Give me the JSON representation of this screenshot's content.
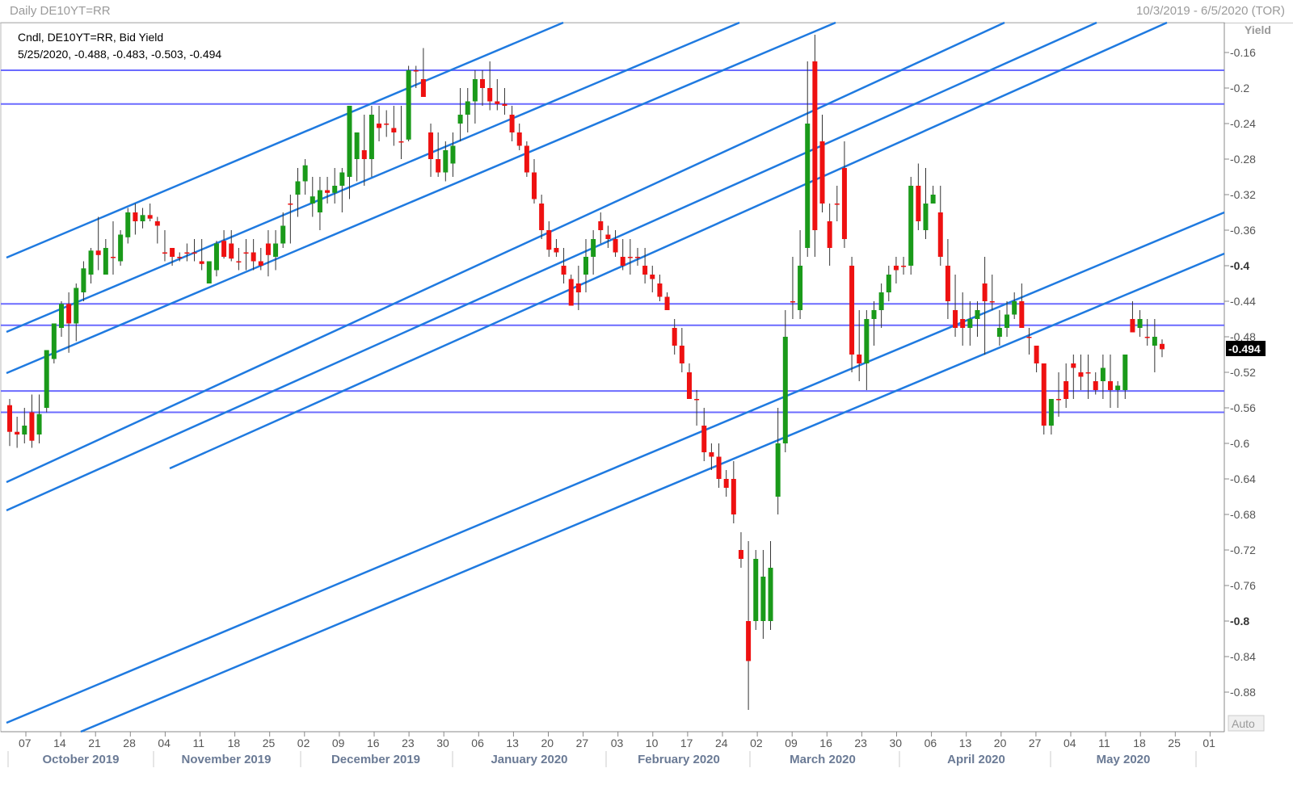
{
  "window": {
    "title": "Daily DE10YT=RR",
    "date_range": "10/3/2019 - 6/5/2020 (TOR)"
  },
  "legend": {
    "line1": "Cndl, DE10YT=RR, Bid Yield",
    "line2": "5/25/2020, -0.488, -0.483, -0.503, -0.494"
  },
  "y_axis": {
    "title": "Yield",
    "auto_label": "Auto",
    "last_value_label": "-0.494"
  },
  "colors": {
    "up": "#1a9a1a",
    "down": "#ee1111",
    "trend_line": "#1f7ae0",
    "horizontal_line": "#6b6bff",
    "last_value_bg": "#000000"
  },
  "chart_data": {
    "type": "candlestick",
    "title": "Cndl, DE10YT=RR, Bid Yield",
    "ylabel": "Yield",
    "ylim": [
      -0.92,
      -0.12
    ],
    "yticks": [
      -0.16,
      -0.2,
      -0.24,
      -0.28,
      -0.32,
      -0.36,
      -0.4,
      -0.44,
      -0.48,
      -0.52,
      -0.56,
      -0.6,
      -0.64,
      -0.68,
      -0.72,
      -0.76,
      -0.8,
      -0.84,
      -0.88
    ],
    "x_tick_labels": [
      "07",
      "14",
      "21",
      "28",
      "04",
      "11",
      "18",
      "25",
      "02",
      "09",
      "16",
      "23",
      "30",
      "06",
      "13",
      "20",
      "27",
      "03",
      "10",
      "17",
      "24",
      "02",
      "09",
      "16",
      "23",
      "30",
      "06",
      "13",
      "20",
      "27",
      "04",
      "11",
      "18",
      "25",
      "01"
    ],
    "month_labels": [
      "October 2019",
      "November 2019",
      "December 2019",
      "January 2020",
      "February 2020",
      "March 2020",
      "April 2020",
      "May 2020"
    ],
    "candles": [
      {
        "date": "2019-10-03",
        "o": -0.557,
        "h": -0.55,
        "l": -0.603,
        "c": -0.587
      },
      {
        "date": "2019-10-04",
        "o": -0.587,
        "h": -0.57,
        "l": -0.605,
        "c": -0.59
      },
      {
        "date": "2019-10-07",
        "o": -0.59,
        "h": -0.56,
        "l": -0.6,
        "c": -0.58
      },
      {
        "date": "2019-10-08",
        "o": -0.565,
        "h": -0.545,
        "l": -0.605,
        "c": -0.597
      },
      {
        "date": "2019-10-09",
        "o": -0.59,
        "h": -0.545,
        "l": -0.6,
        "c": -0.567
      },
      {
        "date": "2019-10-10",
        "o": -0.56,
        "h": -0.495,
        "l": -0.565,
        "c": -0.495
      },
      {
        "date": "2019-10-11",
        "o": -0.505,
        "h": -0.47,
        "l": -0.51,
        "c": -0.465
      },
      {
        "date": "2019-10-14",
        "o": -0.47,
        "h": -0.44,
        "l": -0.48,
        "c": -0.443
      },
      {
        "date": "2019-10-15",
        "o": -0.443,
        "h": -0.43,
        "l": -0.498,
        "c": -0.465
      },
      {
        "date": "2019-10-16",
        "o": -0.465,
        "h": -0.42,
        "l": -0.485,
        "c": -0.425
      },
      {
        "date": "2019-10-17",
        "o": -0.43,
        "h": -0.395,
        "l": -0.44,
        "c": -0.403
      },
      {
        "date": "2019-10-18",
        "o": -0.41,
        "h": -0.38,
        "l": -0.42,
        "c": -0.383
      },
      {
        "date": "2019-10-21",
        "o": -0.383,
        "h": -0.345,
        "l": -0.405,
        "c": -0.388
      },
      {
        "date": "2019-10-22",
        "o": -0.41,
        "h": -0.37,
        "l": -0.41,
        "c": -0.38
      },
      {
        "date": "2019-10-23",
        "o": -0.39,
        "h": -0.35,
        "l": -0.41,
        "c": -0.39
      },
      {
        "date": "2019-10-24",
        "o": -0.395,
        "h": -0.36,
        "l": -0.4,
        "c": -0.365
      },
      {
        "date": "2019-10-25",
        "o": -0.368,
        "h": -0.335,
        "l": -0.375,
        "c": -0.34
      },
      {
        "date": "2019-10-28",
        "o": -0.34,
        "h": -0.33,
        "l": -0.365,
        "c": -0.35
      },
      {
        "date": "2019-10-29",
        "o": -0.35,
        "h": -0.335,
        "l": -0.358,
        "c": -0.343
      },
      {
        "date": "2019-10-30",
        "o": -0.343,
        "h": -0.33,
        "l": -0.35,
        "c": -0.347
      },
      {
        "date": "2019-10-31",
        "o": -0.35,
        "h": -0.345,
        "l": -0.375,
        "c": -0.355
      },
      {
        "date": "2019-11-01",
        "o": -0.385,
        "h": -0.36,
        "l": -0.395,
        "c": -0.385
      },
      {
        "date": "2019-11-04",
        "o": -0.38,
        "h": -0.385,
        "l": -0.4,
        "c": -0.39
      },
      {
        "date": "2019-11-05",
        "o": -0.39,
        "h": -0.385,
        "l": -0.395,
        "c": -0.39
      },
      {
        "date": "2019-11-06",
        "o": -0.385,
        "h": -0.375,
        "l": -0.395,
        "c": -0.385
      },
      {
        "date": "2019-11-07",
        "o": -0.385,
        "h": -0.37,
        "l": -0.395,
        "c": -0.385
      },
      {
        "date": "2019-11-08",
        "o": -0.395,
        "h": -0.37,
        "l": -0.405,
        "c": -0.398
      },
      {
        "date": "2019-11-11",
        "o": -0.42,
        "h": -0.395,
        "l": -0.4,
        "c": -0.395
      },
      {
        "date": "2019-11-12",
        "o": -0.405,
        "h": -0.372,
        "l": -0.412,
        "c": -0.375
      },
      {
        "date": "2019-11-13",
        "o": -0.372,
        "h": -0.36,
        "l": -0.392,
        "c": -0.39
      },
      {
        "date": "2019-11-14",
        "o": -0.375,
        "h": -0.36,
        "l": -0.395,
        "c": -0.392
      },
      {
        "date": "2019-11-15",
        "o": -0.395,
        "h": -0.38,
        "l": -0.405,
        "c": -0.395
      },
      {
        "date": "2019-11-18",
        "o": -0.385,
        "h": -0.37,
        "l": -0.405,
        "c": -0.385
      },
      {
        "date": "2019-11-19",
        "o": -0.385,
        "h": -0.37,
        "l": -0.405,
        "c": -0.395
      },
      {
        "date": "2019-11-20",
        "o": -0.395,
        "h": -0.38,
        "l": -0.405,
        "c": -0.4
      },
      {
        "date": "2019-11-21",
        "o": -0.375,
        "h": -0.36,
        "l": -0.412,
        "c": -0.388
      }
    ]
  }
}
